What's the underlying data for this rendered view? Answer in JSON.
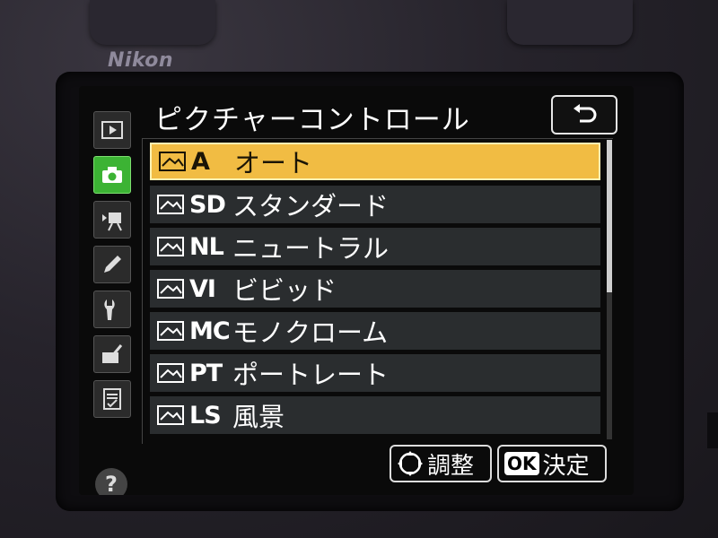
{
  "camera": {
    "brand": "Nikon"
  },
  "screen": {
    "title": "ピクチャーコントロール",
    "sidebar": {
      "items": [
        {
          "name": "playback",
          "icon": "play-icon",
          "active": false
        },
        {
          "name": "shooting",
          "icon": "camera-icon",
          "active": true
        },
        {
          "name": "movie",
          "icon": "movie-camera-icon",
          "active": false
        },
        {
          "name": "custom-settings",
          "icon": "pencil-icon",
          "active": false
        },
        {
          "name": "setup",
          "icon": "wrench-icon",
          "active": false
        },
        {
          "name": "retouch",
          "icon": "retouch-brush-icon",
          "active": false
        },
        {
          "name": "my-menu",
          "icon": "checklist-icon",
          "active": false
        }
      ],
      "help_label": "?"
    },
    "list": [
      {
        "code": "A",
        "label": "オート",
        "selected": true
      },
      {
        "code": "SD",
        "label": "スタンダード",
        "selected": false
      },
      {
        "code": "NL",
        "label": "ニュートラル",
        "selected": false
      },
      {
        "code": "VI",
        "label": "ビビッド",
        "selected": false
      },
      {
        "code": "MC",
        "label": "モノクローム",
        "selected": false
      },
      {
        "code": "PT",
        "label": "ポートレート",
        "selected": false
      },
      {
        "code": "LS",
        "label": "風景",
        "selected": false
      }
    ],
    "footer": {
      "adjust_label": "調整",
      "ok_badge": "OK",
      "confirm_label": "決定"
    },
    "colors": {
      "selected_row": "#f1bc43",
      "active_tab": "#3cb334",
      "row_bg": "#2a2d2f"
    }
  }
}
